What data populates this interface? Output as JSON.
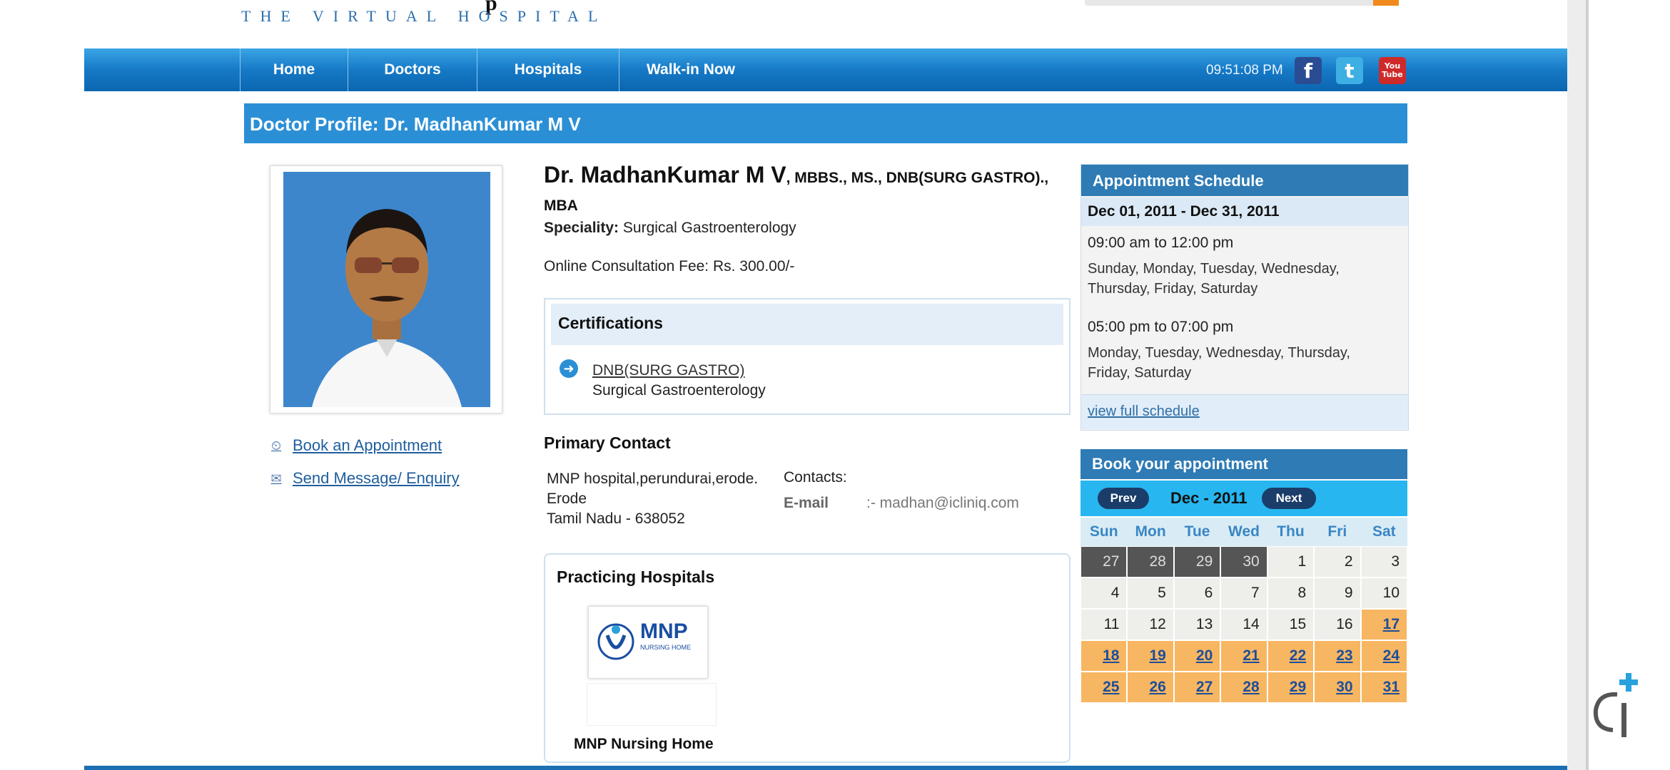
{
  "header": {
    "tagline": "THE VIRTUAL HOSPITAL",
    "logo_fragment": "p"
  },
  "nav": {
    "items": [
      "Home",
      "Doctors",
      "Hospitals",
      "Walk-in Now"
    ],
    "time": "09:51:08 PM",
    "social": [
      "facebook-icon",
      "twitter-icon",
      "youtube-icon"
    ],
    "youtube_label_1": "You",
    "youtube_label_2": "Tube"
  },
  "profile": {
    "page_title": "Doctor Profile: Dr. MadhanKumar M V",
    "name": "Dr. MadhanKumar M V",
    "qualifications": ", MBBS., MS., DNB(SURG GASTRO)., MBA",
    "speciality_label": "Speciality:",
    "speciality": "Surgical Gastroenterology",
    "fee": "Online Consultation Fee: Rs. 300.00/-"
  },
  "actions": {
    "book": "Book an Appointment",
    "message": "Send Message/ Enquiry"
  },
  "certifications": {
    "title": "Certifications",
    "items": [
      {
        "name": "DNB(SURG GASTRO)",
        "field": "Surgical Gastroenterology"
      }
    ]
  },
  "contact": {
    "title": "Primary Contact",
    "address_1": "MNP hospital,perundurai,erode.",
    "address_2": "Erode",
    "address_3": "Tamil Nadu - 638052",
    "contacts_label": "Contacts:",
    "email_label": "E-mail",
    "email_value": ":- madhan@icliniq.com"
  },
  "hospitals": {
    "title": "Practicing Hospitals",
    "logo_text": "MNP",
    "logo_sub": "NURSING HOME",
    "name": "MNP Nursing Home"
  },
  "schedule": {
    "title": "Appointment Schedule",
    "range": "Dec 01, 2011 - Dec 31, 2011",
    "slots": [
      {
        "time": "09:00 am to 12:00 pm",
        "days": "Sunday, Monday, Tuesday, Wednesday, Thursday, Friday, Saturday"
      },
      {
        "time": "05:00 pm to 07:00 pm",
        "days": "Monday, Tuesday, Wednesday, Thursday, Friday, Saturday"
      }
    ],
    "full_link": "view full schedule"
  },
  "booking": {
    "title": "Book your appointment",
    "prev": "Prev",
    "next": "Next",
    "month": "Dec - 2011",
    "weekdays": [
      "Sun",
      "Mon",
      "Tue",
      "Wed",
      "Thu",
      "Fri",
      "Sat"
    ],
    "days": [
      {
        "d": "27",
        "s": "prev"
      },
      {
        "d": "28",
        "s": "prev"
      },
      {
        "d": "29",
        "s": "prev"
      },
      {
        "d": "30",
        "s": "prev"
      },
      {
        "d": "1",
        "s": "past"
      },
      {
        "d": "2",
        "s": "past"
      },
      {
        "d": "3",
        "s": "past"
      },
      {
        "d": "4",
        "s": "past"
      },
      {
        "d": "5",
        "s": "past"
      },
      {
        "d": "6",
        "s": "past"
      },
      {
        "d": "7",
        "s": "past"
      },
      {
        "d": "8",
        "s": "past"
      },
      {
        "d": "9",
        "s": "past"
      },
      {
        "d": "10",
        "s": "past"
      },
      {
        "d": "11",
        "s": "past"
      },
      {
        "d": "12",
        "s": "past"
      },
      {
        "d": "13",
        "s": "past"
      },
      {
        "d": "14",
        "s": "past"
      },
      {
        "d": "15",
        "s": "past"
      },
      {
        "d": "16",
        "s": "past"
      },
      {
        "d": "17",
        "s": "avail"
      },
      {
        "d": "18",
        "s": "avail"
      },
      {
        "d": "19",
        "s": "avail"
      },
      {
        "d": "20",
        "s": "avail"
      },
      {
        "d": "21",
        "s": "avail"
      },
      {
        "d": "22",
        "s": "avail"
      },
      {
        "d": "23",
        "s": "avail"
      },
      {
        "d": "24",
        "s": "avail"
      },
      {
        "d": "25",
        "s": "avail"
      },
      {
        "d": "26",
        "s": "avail"
      },
      {
        "d": "27",
        "s": "avail"
      },
      {
        "d": "28",
        "s": "avail"
      },
      {
        "d": "29",
        "s": "avail"
      },
      {
        "d": "30",
        "s": "avail"
      },
      {
        "d": "31",
        "s": "avail"
      }
    ]
  },
  "colors": {
    "nav_blue": "#1679c6",
    "title_bar": "#2b8fd6",
    "available_day": "#f7b661"
  }
}
